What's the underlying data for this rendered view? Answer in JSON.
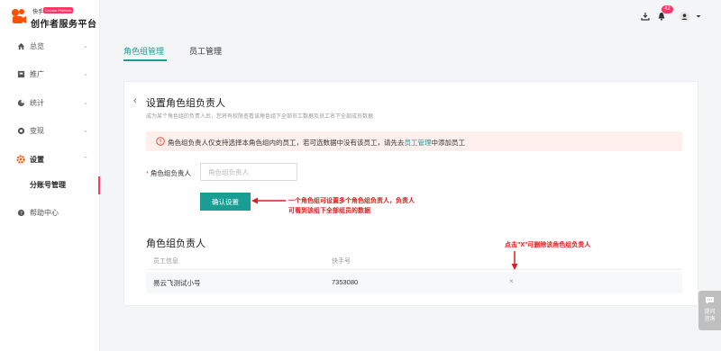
{
  "brand": {
    "small": "快手",
    "badge": "Creator Platform",
    "title": "创作者服务平台",
    "colors": {
      "accent": "#1a9e94",
      "brand": "#fe3666",
      "annotation": "#e31b1b"
    }
  },
  "sidebar": {
    "items": [
      {
        "label": "总览",
        "icon": "home-icon",
        "caret": "⌄"
      },
      {
        "label": "推广",
        "icon": "promotion-icon",
        "caret": "⌄"
      },
      {
        "label": "统计",
        "icon": "stats-icon",
        "caret": "⌄"
      },
      {
        "label": "变现",
        "icon": "monetize-icon",
        "caret": "⌄"
      },
      {
        "label": "设置",
        "icon": "settings-icon",
        "caret": "⌃"
      },
      {
        "label": "帮助中心",
        "icon": "help-icon"
      }
    ],
    "sub_items": [
      {
        "label": "分账号管理"
      }
    ]
  },
  "topbar": {
    "notification_count": "42",
    "icons": [
      "download-icon",
      "bell-icon",
      "user-avatar-icon",
      "dropdown-icon"
    ]
  },
  "tabs": [
    {
      "label": "角色组管理",
      "active": true
    },
    {
      "label": "员工管理",
      "active": false
    }
  ],
  "card": {
    "back_icon": "‹",
    "title": "设置角色组负责人",
    "description": "成为某个角色组的负责人后，您将有权限查看该角色组下全部员工数据及员工名下全部成员数据",
    "alert": {
      "text_before": "角色组负责人仅支持选择本角色组内的员工，若可选数据中没有该员工，请先去",
      "link": "员工管理",
      "text_after": "中添加员工"
    },
    "field": {
      "required_mark": "*",
      "label": "角色组负责人",
      "placeholder": "角色组负责人"
    },
    "confirm_button": "确认设置",
    "section_title": "角色组负责人",
    "table": {
      "columns": [
        "员工信息",
        "快手号"
      ],
      "rows": [
        {
          "name": "易云飞测试小号",
          "kuaishou_id": "7353080",
          "remove": "×"
        }
      ]
    }
  },
  "annotations": {
    "confirm_note_line1": "一个角色组可设置多个角色组负责人，负责人",
    "confirm_note_line2": "可看到该组下全部组员的数据",
    "remove_note": "点击\"X\"可删除该角色组负责人"
  },
  "float_help": {
    "label_line1": "提问",
    "label_line2": "咨询"
  }
}
